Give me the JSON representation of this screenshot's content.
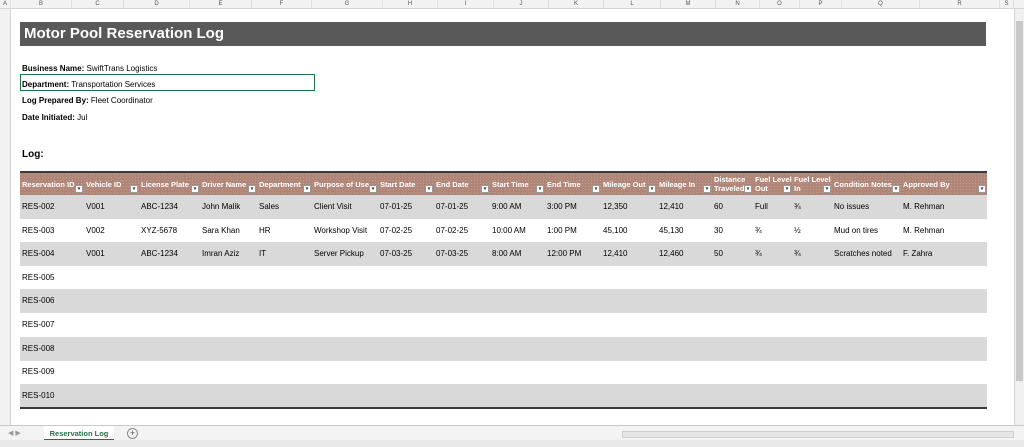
{
  "column_letters": [
    "A",
    "B",
    "C",
    "D",
    "E",
    "F",
    "G",
    "H",
    "I",
    "J",
    "K",
    "L",
    "M",
    "N",
    "O",
    "P",
    "Q",
    "R",
    "S"
  ],
  "title": "Motor Pool Reservation Log",
  "info": {
    "business_label": "Business Name:",
    "business_value": "SwiftTrans Logistics",
    "department_label": "Department:",
    "department_value": "Transportation Services",
    "prepared_label": "Log Prepared By:",
    "prepared_value": "Fleet Coordinator",
    "date_label": "Date Initiated:",
    "date_value": "Jul"
  },
  "log_label": "Log:",
  "table": {
    "headers": [
      "Reservation ID",
      "Vehicle ID",
      "License Plate",
      "Driver Name",
      "Department",
      "Purpose of Use",
      "Start Date",
      "End Date",
      "Start Time",
      "End Time",
      "Mileage Out",
      "Mileage In",
      "Distance Traveled",
      "Fuel Level Out",
      "Fuel Level In",
      "Condition Notes",
      "Approved By"
    ],
    "rows": [
      [
        "RES-002",
        "V001",
        "ABC-1234",
        "John Malik",
        "Sales",
        "Client Visit",
        "07-01-25",
        "07-01-25",
        "9:00 AM",
        "3:00 PM",
        "12,350",
        "12,410",
        "60",
        "Full",
        "¾",
        "No issues",
        "M. Rehman"
      ],
      [
        "RES-003",
        "V002",
        "XYZ-5678",
        "Sara Khan",
        "HR",
        "Workshop Visit",
        "07-02-25",
        "07-02-25",
        "10:00 AM",
        "1:00 PM",
        "45,100",
        "45,130",
        "30",
        "¾",
        "½",
        "Mud on tires",
        "M. Rehman"
      ],
      [
        "RES-004",
        "V001",
        "ABC-1234",
        "Imran Aziz",
        "IT",
        "Server Pickup",
        "07-03-25",
        "07-03-25",
        "8:00 AM",
        "12:00 PM",
        "12,410",
        "12,460",
        "50",
        "¾",
        "¾",
        "Scratches noted",
        "F. Zahra"
      ],
      [
        "RES-005",
        "",
        "",
        "",
        "",
        "",
        "",
        "",
        "",
        "",
        "",
        "",
        "",
        "",
        "",
        "",
        ""
      ],
      [
        "RES-006",
        "",
        "",
        "",
        "",
        "",
        "",
        "",
        "",
        "",
        "",
        "",
        "",
        "",
        "",
        "",
        ""
      ],
      [
        "RES-007",
        "",
        "",
        "",
        "",
        "",
        "",
        "",
        "",
        "",
        "",
        "",
        "",
        "",
        "",
        "",
        ""
      ],
      [
        "RES-008",
        "",
        "",
        "",
        "",
        "",
        "",
        "",
        "",
        "",
        "",
        "",
        "",
        "",
        "",
        "",
        ""
      ],
      [
        "RES-009",
        "",
        "",
        "",
        "",
        "",
        "",
        "",
        "",
        "",
        "",
        "",
        "",
        "",
        "",
        "",
        ""
      ],
      [
        "RES-010",
        "",
        "",
        "",
        "",
        "",
        "",
        "",
        "",
        "",
        "",
        "",
        "",
        "",
        "",
        "",
        ""
      ]
    ]
  },
  "sheet_tab": "Reservation Log",
  "add_sheet_icon": "+",
  "colors": {
    "title_bg": "#595959",
    "header_bg": "#b08678",
    "band": "#d9d9d9",
    "accent": "#217346"
  }
}
